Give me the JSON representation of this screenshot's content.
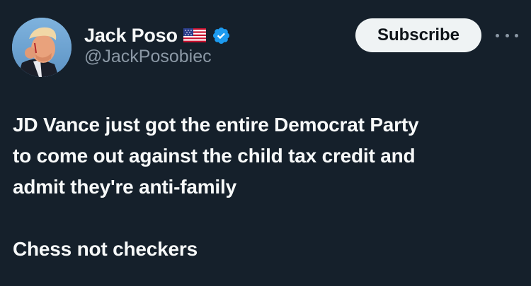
{
  "author": {
    "display_name": "Jack Poso",
    "handle": "@JackPosobiec",
    "flag_icon": "us-flag-icon",
    "verified_icon": "verified-badge-icon",
    "verified_color": "#1d9bf0"
  },
  "actions": {
    "subscribe_label": "Subscribe",
    "more_icon": "more-options-icon"
  },
  "post": {
    "line1": "JD Vance just got the entire Democrat Party",
    "line2": "to come out against the child tax credit and",
    "line3": "admit they're anti-family",
    "line4": "Chess not checkers"
  },
  "colors": {
    "background": "#15202b",
    "text": "#f7f9f9",
    "secondary_text": "#8b98a5",
    "button_bg": "#eff3f4"
  }
}
